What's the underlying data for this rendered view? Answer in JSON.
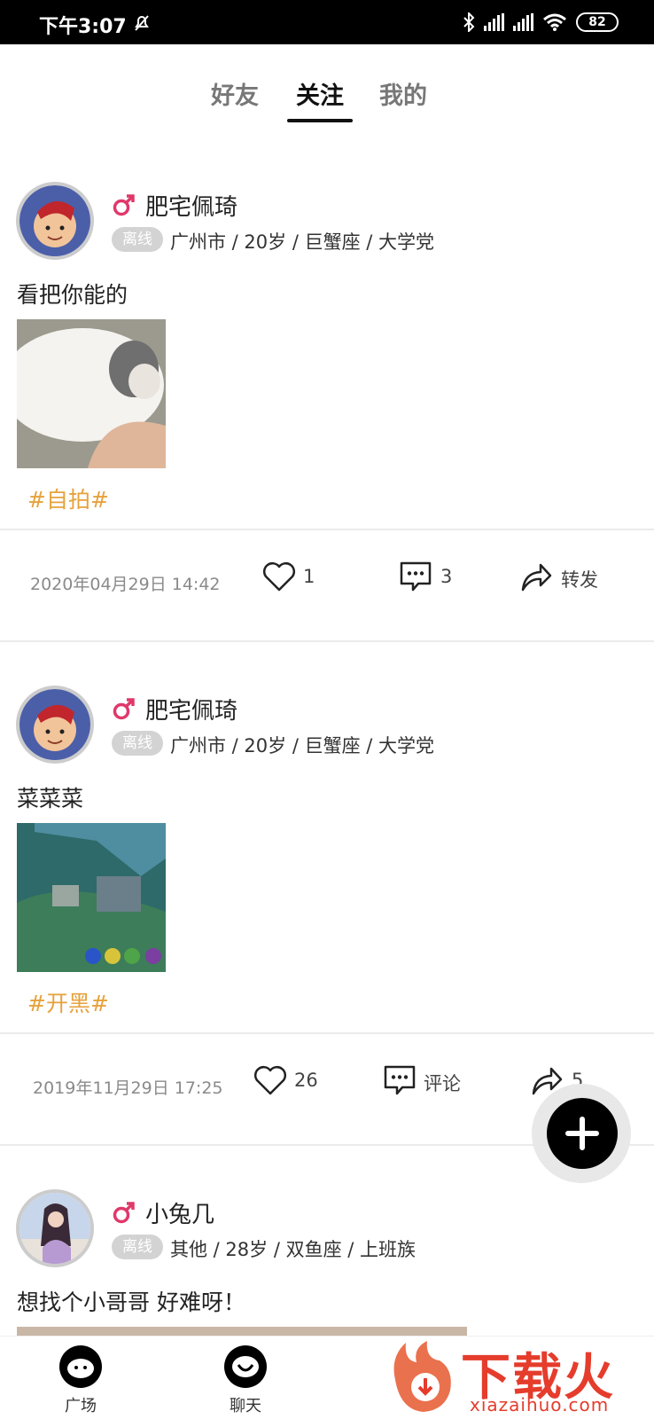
{
  "status_bar": {
    "time": "下午3:07",
    "battery": "82"
  },
  "tabs": [
    {
      "label": "好友",
      "active": false
    },
    {
      "label": "关注",
      "active": true
    },
    {
      "label": "我的",
      "active": false
    }
  ],
  "posts": [
    {
      "user": "肥宅佩琦",
      "status": "离线",
      "info": "广州市 / 20岁 / 巨蟹座 / 大学党",
      "text": "看把你能的",
      "tag": "#自拍#",
      "time": "2020年04月29日 14:42",
      "likes": "1",
      "comments": "3",
      "share": "转发"
    },
    {
      "user": "肥宅佩琦",
      "status": "离线",
      "info": "广州市 / 20岁 / 巨蟹座 / 大学党",
      "text": "菜菜菜",
      "tag": "#开黑#",
      "time": "2019年11月29日 17:25",
      "likes": "26",
      "comments": "评论",
      "share": "5"
    },
    {
      "user": "小兔几",
      "status": "离线",
      "info": "其他 / 28岁 / 双鱼座 / 上班族",
      "text": "想找个小哥哥 好难呀！"
    }
  ],
  "bottom_nav": [
    {
      "label": "广场",
      "icon": "plaza-icon"
    },
    {
      "label": "聊天",
      "icon": "chat-icon"
    }
  ],
  "watermark": {
    "cn": "下载火",
    "en": "xiazaihuo.com"
  },
  "colors": {
    "tag": "#e6a23c",
    "gender": "#e0386a",
    "watermark": "#e53c2c"
  }
}
